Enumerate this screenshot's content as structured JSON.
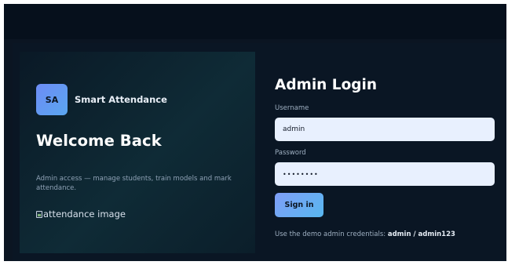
{
  "brand": {
    "logo_text": "SA",
    "name": "Smart Attendance"
  },
  "welcome": {
    "title": "Welcome Back",
    "description": "Admin access — manage students, train models and mark attendance.",
    "image_alt": "attendance image"
  },
  "login": {
    "title": "Admin Login",
    "username_label": "Username",
    "username_value": "admin",
    "password_label": "Password",
    "password_value": "••••••••",
    "signin_label": "Sign in",
    "hint_prefix": "Use the demo admin credentials: ",
    "hint_credentials": "admin / admin123"
  },
  "colors": {
    "background": "#0b1522",
    "accent_start": "#7f9ef7",
    "accent_end": "#58b7ef",
    "input_bg": "#e8f0fe"
  }
}
